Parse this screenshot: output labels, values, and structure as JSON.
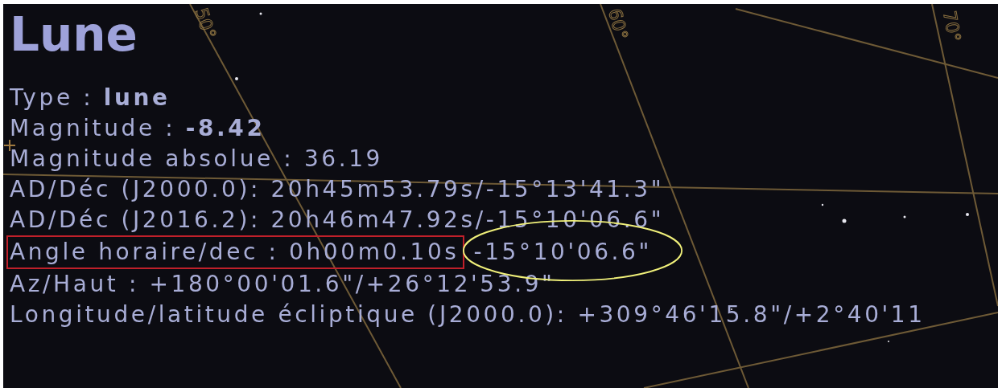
{
  "object": {
    "title": "Lune",
    "lines": [
      {
        "kind": "plain",
        "text": "Type : **lune**"
      },
      {
        "kind": "plain",
        "text": "Magnitude : **-8.42**"
      },
      {
        "kind": "plain",
        "text": "Magnitude absolue : 36.19"
      },
      {
        "kind": "plain",
        "text": "AD/Déc (J2000.0): 20h45m53.79s/-15°13'41.3\""
      },
      {
        "kind": "plain",
        "text": "AD/Déc (J2016.2): 20h46m47.92s/-15°10'06.6\""
      },
      {
        "kind": "annotated",
        "boxed": "Angle horaire/dec : 0h00m0.10s",
        "circled": "-15°10'06.6\""
      },
      {
        "kind": "plain",
        "text": "Az/Haut : +180°00'01.6\"/+26°12'53.9\""
      },
      {
        "kind": "plain",
        "text": "Longitude/latitude écliptique (J2000.0): +309°46'15.8\"/+2°40'11"
      }
    ]
  },
  "grid_labels": [
    "50°",
    "60°",
    "70°"
  ]
}
